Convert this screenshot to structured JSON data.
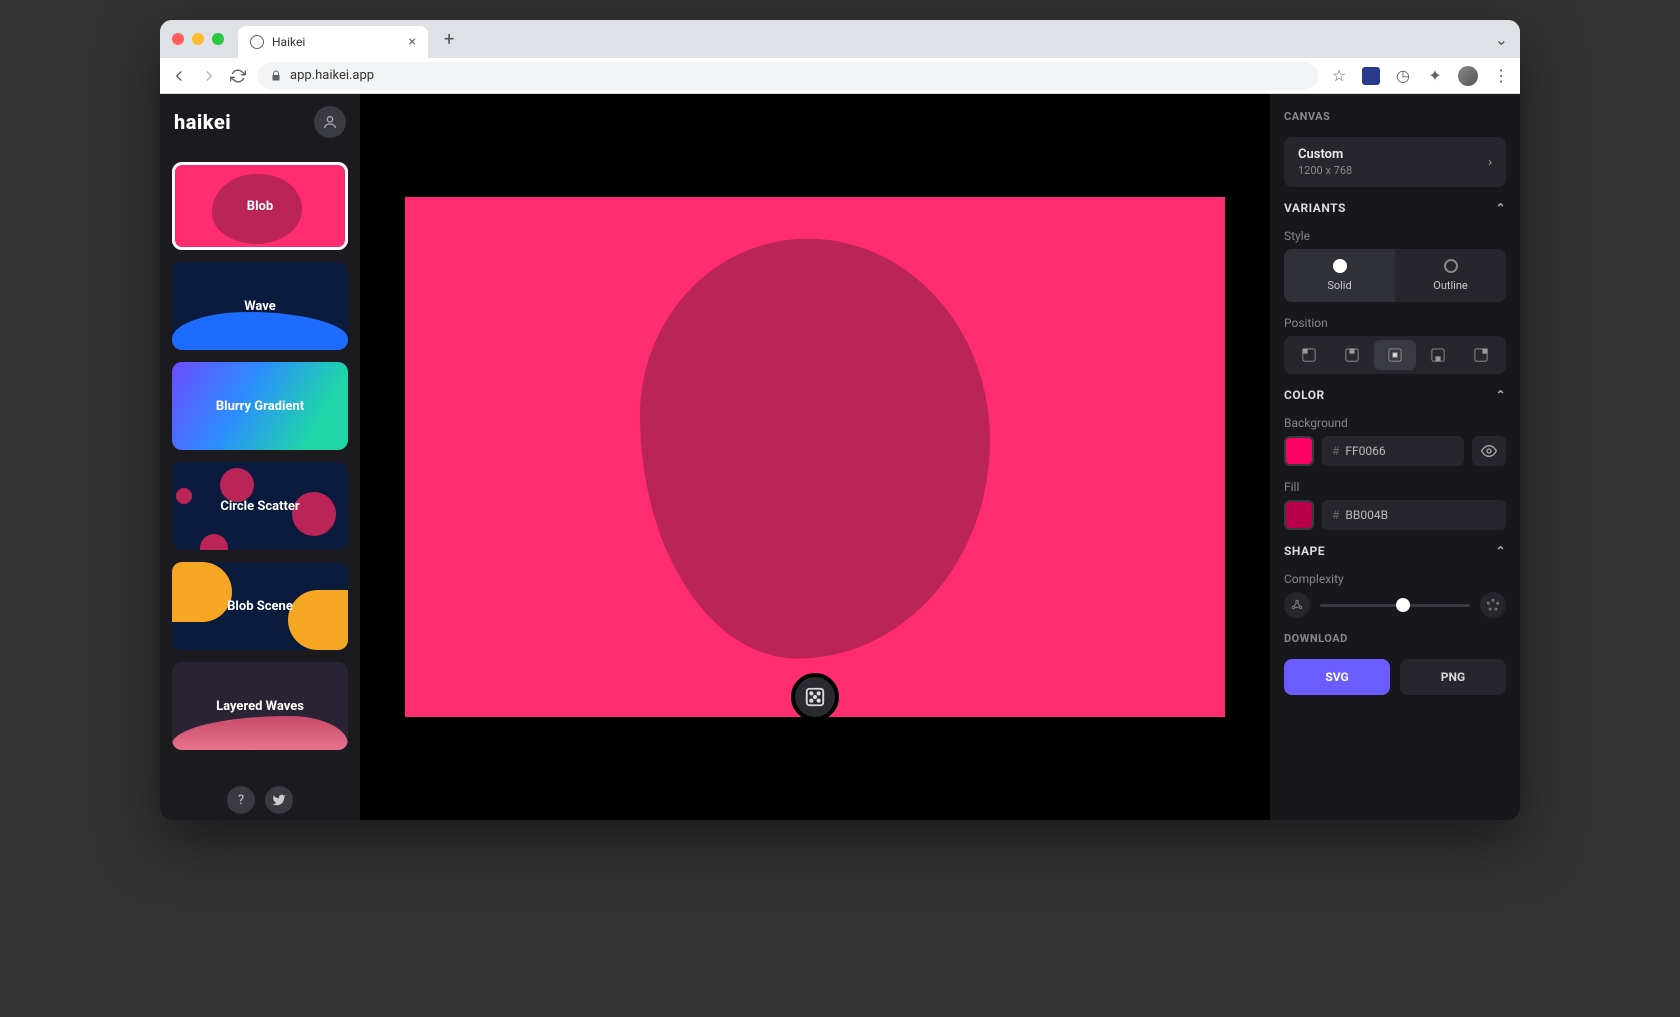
{
  "browser": {
    "tab_title": "Haikei",
    "url": "app.haikei.app"
  },
  "brand": "haikei",
  "generators": [
    {
      "id": "blob",
      "label": "Blob",
      "selected": true
    },
    {
      "id": "wave",
      "label": "Wave",
      "selected": false
    },
    {
      "id": "gradient",
      "label": "Blurry Gradient",
      "selected": false
    },
    {
      "id": "scatter",
      "label": "Circle Scatter",
      "selected": false
    },
    {
      "id": "bscene",
      "label": "Blob Scene",
      "selected": false
    },
    {
      "id": "lwave",
      "label": "Layered Waves",
      "selected": false
    }
  ],
  "canvas": {
    "section": "CANVAS",
    "size_name": "Custom",
    "size_value": "1200 x 768",
    "bg_color": "#ff2d6f",
    "blob_color": "#bb2456"
  },
  "variants": {
    "section": "VARIANTS",
    "style_label": "Style",
    "solid": "Solid",
    "outline": "Outline",
    "position_label": "Position"
  },
  "color": {
    "section": "COLOR",
    "bg_label": "Background",
    "bg_hex": "FF0066",
    "fill_label": "Fill",
    "fill_hex": "BB004B"
  },
  "shape": {
    "section": "SHAPE",
    "complexity_label": "Complexity",
    "complexity_value": 55
  },
  "download": {
    "section": "DOWNLOAD",
    "svg": "SVG",
    "png": "PNG"
  }
}
